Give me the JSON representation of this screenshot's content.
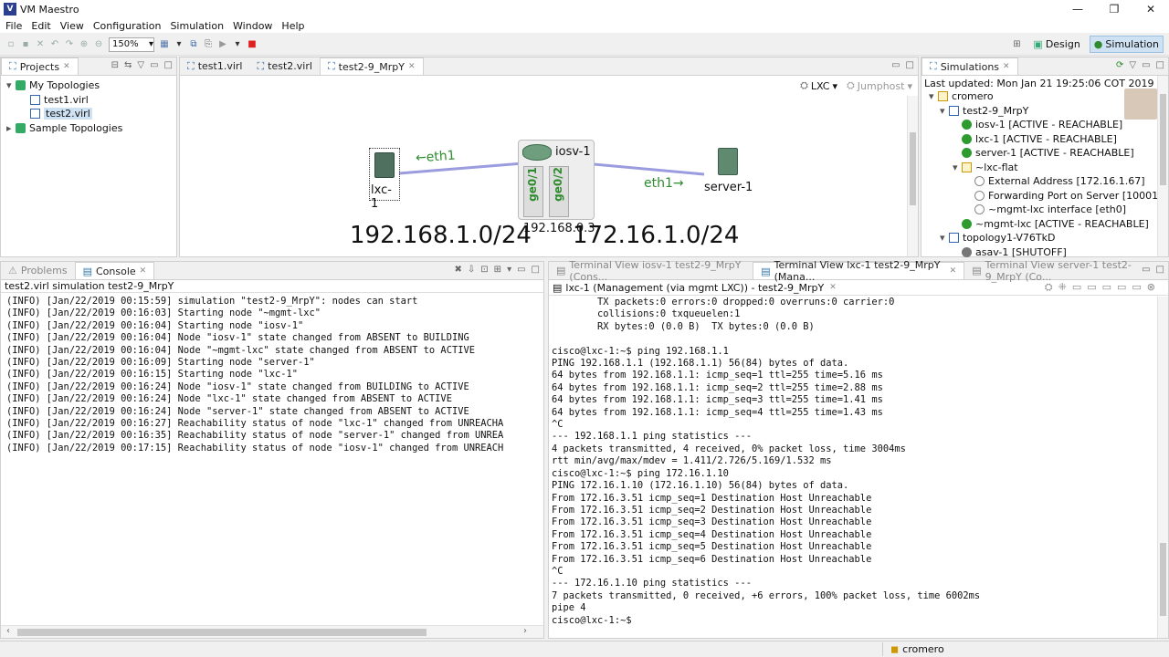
{
  "window": {
    "title": "VM Maestro",
    "minimize": "—",
    "maximize": "❐",
    "close": "✕"
  },
  "menu": [
    "File",
    "Edit",
    "View",
    "Configuration",
    "Simulation",
    "Window",
    "Help"
  ],
  "toolbar": {
    "zoom": "150%",
    "design_label": "Design",
    "simulation_label": "Simulation"
  },
  "projects": {
    "tab": "Projects",
    "items": [
      {
        "label": "My Topologies"
      },
      {
        "label": "test1.virl"
      },
      {
        "label": "test2.virl"
      },
      {
        "label": "Sample Topologies"
      }
    ]
  },
  "editor": {
    "tabs": [
      "test1.virl",
      "test2.virl",
      "test2-9_MrpY"
    ],
    "lxc_label": "LXC",
    "jumphost_label": "Jumphost",
    "nodes": {
      "lxc": "lxc-1",
      "iosv": "iosv-1",
      "server": "server-1"
    },
    "links": {
      "eth1_left": "←eth1",
      "eth1_right": "eth1→",
      "ge01": "ge0/1",
      "ge02": "ge0/2"
    },
    "subnets": {
      "left": "192.168.1.0/24",
      "mid": "192.168.0.3",
      "right": "172.16.1.0/24"
    }
  },
  "simulations": {
    "tab": "Simulations",
    "updated": "Last updated: Mon Jan 21 19:25:06 COT 2019",
    "items": [
      {
        "label": "cromero"
      },
      {
        "label": "test2-9_MrpY"
      },
      {
        "label": "iosv-1  [ACTIVE - REACHABLE]"
      },
      {
        "label": "lxc-1  [ACTIVE - REACHABLE]"
      },
      {
        "label": "server-1  [ACTIVE - REACHABLE]"
      },
      {
        "label": "~lxc-flat"
      },
      {
        "label": "External Address  [172.16.1.67]"
      },
      {
        "label": "Forwarding Port on Server  [10001]"
      },
      {
        "label": "~mgmt-lxc interface  [eth0]"
      },
      {
        "label": "~mgmt-lxc  [ACTIVE - REACHABLE]"
      },
      {
        "label": "topology1-V76TkD"
      },
      {
        "label": "asav-1  [SHUTOFF]"
      }
    ]
  },
  "console": {
    "tabs": [
      "Problems",
      "Console"
    ],
    "header": "test2.virl simulation test2-9_MrpY",
    "lines": [
      "(INFO) [Jan/22/2019 00:15:59] simulation \"test2-9_MrpY\": nodes can start",
      "(INFO) [Jan/22/2019 00:16:03] Starting node \"~mgmt-lxc\"",
      "(INFO) [Jan/22/2019 00:16:04] Starting node \"iosv-1\"",
      "(INFO) [Jan/22/2019 00:16:04] Node \"iosv-1\" state changed from ABSENT to BUILDING",
      "(INFO) [Jan/22/2019 00:16:04] Node \"~mgmt-lxc\" state changed from ABSENT to ACTIVE",
      "(INFO) [Jan/22/2019 00:16:09] Starting node \"server-1\"",
      "(INFO) [Jan/22/2019 00:16:15] Starting node \"lxc-1\"",
      "(INFO) [Jan/22/2019 00:16:24] Node \"iosv-1\" state changed from BUILDING to ACTIVE",
      "(INFO) [Jan/22/2019 00:16:24] Node \"lxc-1\" state changed from ABSENT to ACTIVE",
      "(INFO) [Jan/22/2019 00:16:24] Node \"server-1\" state changed from ABSENT to ACTIVE",
      "(INFO) [Jan/22/2019 00:16:27] Reachability status of node \"lxc-1\" changed from UNREACHA",
      "(INFO) [Jan/22/2019 00:16:35] Reachability status of node \"server-1\" changed from UNREA",
      "(INFO) [Jan/22/2019 00:17:15] Reachability status of node \"iosv-1\" changed from UNREACH"
    ]
  },
  "terminal": {
    "tabs": [
      "Terminal View iosv-1 test2-9_MrpY (Cons...",
      "Terminal View lxc-1 test2-9_MrpY (Mana...",
      "Terminal View server-1 test2-9_MrpY (Co..."
    ],
    "subtab": "lxc-1 (Management (via mgmt LXC)) - test2-9_MrpY",
    "lines": [
      "        TX packets:0 errors:0 dropped:0 overruns:0 carrier:0",
      "        collisions:0 txqueuelen:1",
      "        RX bytes:0 (0.0 B)  TX bytes:0 (0.0 B)",
      "",
      "cisco@lxc-1:~$ ping 192.168.1.1",
      "PING 192.168.1.1 (192.168.1.1) 56(84) bytes of data.",
      "64 bytes from 192.168.1.1: icmp_seq=1 ttl=255 time=5.16 ms",
      "64 bytes from 192.168.1.1: icmp_seq=2 ttl=255 time=2.88 ms",
      "64 bytes from 192.168.1.1: icmp_seq=3 ttl=255 time=1.41 ms",
      "64 bytes from 192.168.1.1: icmp_seq=4 ttl=255 time=1.43 ms",
      "^C",
      "--- 192.168.1.1 ping statistics ---",
      "4 packets transmitted, 4 received, 0% packet loss, time 3004ms",
      "rtt min/avg/max/mdev = 1.411/2.726/5.169/1.532 ms",
      "cisco@lxc-1:~$ ping 172.16.1.10",
      "PING 172.16.1.10 (172.16.1.10) 56(84) bytes of data.",
      "From 172.16.3.51 icmp_seq=1 Destination Host Unreachable",
      "From 172.16.3.51 icmp_seq=2 Destination Host Unreachable",
      "From 172.16.3.51 icmp_seq=3 Destination Host Unreachable",
      "From 172.16.3.51 icmp_seq=4 Destination Host Unreachable",
      "From 172.16.3.51 icmp_seq=5 Destination Host Unreachable",
      "From 172.16.3.51 icmp_seq=6 Destination Host Unreachable",
      "^C",
      "--- 172.16.1.10 ping statistics ---",
      "7 packets transmitted, 0 received, +6 errors, 100% packet loss, time 6002ms",
      "pipe 4",
      "cisco@lxc-1:~$ "
    ]
  },
  "status": {
    "user": "cromero"
  },
  "colors": {
    "link": "#9b9be0",
    "accent": "#2e8b2e",
    "selection": "#cfe2f3"
  }
}
